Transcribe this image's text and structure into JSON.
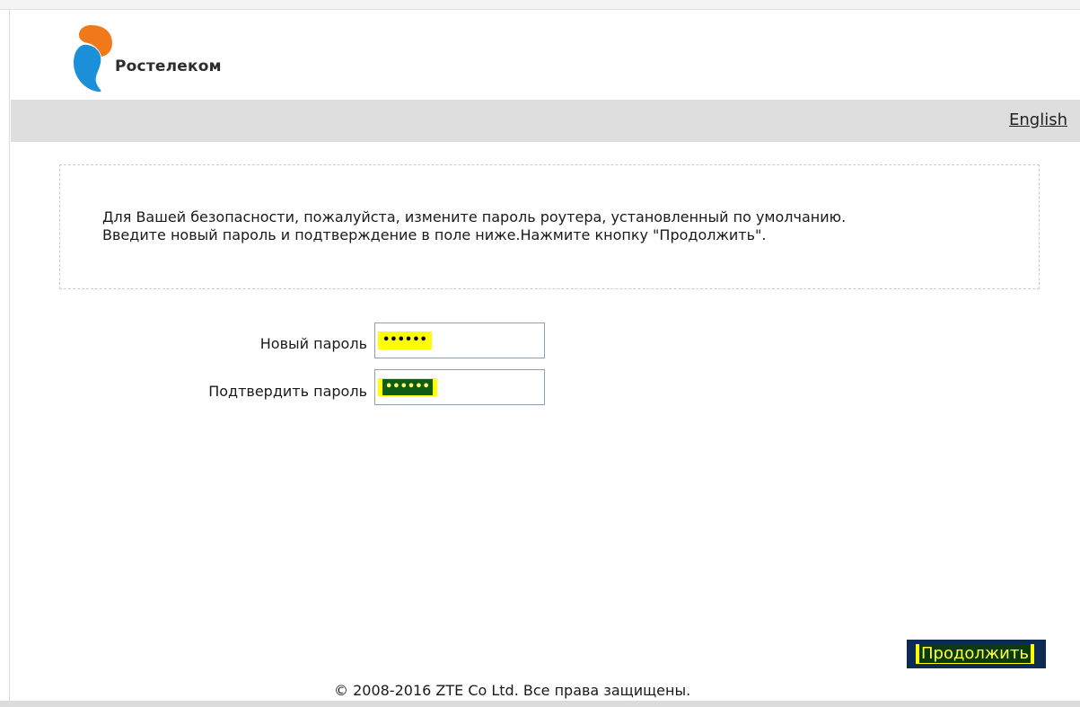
{
  "brand": {
    "name": "Ростелеком",
    "colors": {
      "orange": "#f07a1a",
      "blue": "#1b8fd8"
    }
  },
  "language_link": "English",
  "info": {
    "line1": "Для Вашей безопасности, пожалуйста, измените пароль роутера, установленный по умолчанию.",
    "line2": "Введите новый пароль и подтверждение в поле ниже.Нажмите кнопку \"Продолжить\"."
  },
  "form": {
    "new_password_label": "Новый пароль",
    "new_password_value": "••••••",
    "confirm_password_label": "Подтвердить пароль",
    "confirm_password_value": "••••••"
  },
  "continue_label": "Продолжить",
  "footer": "© 2008-2016 ZTE Co Ltd. Все права защищены."
}
